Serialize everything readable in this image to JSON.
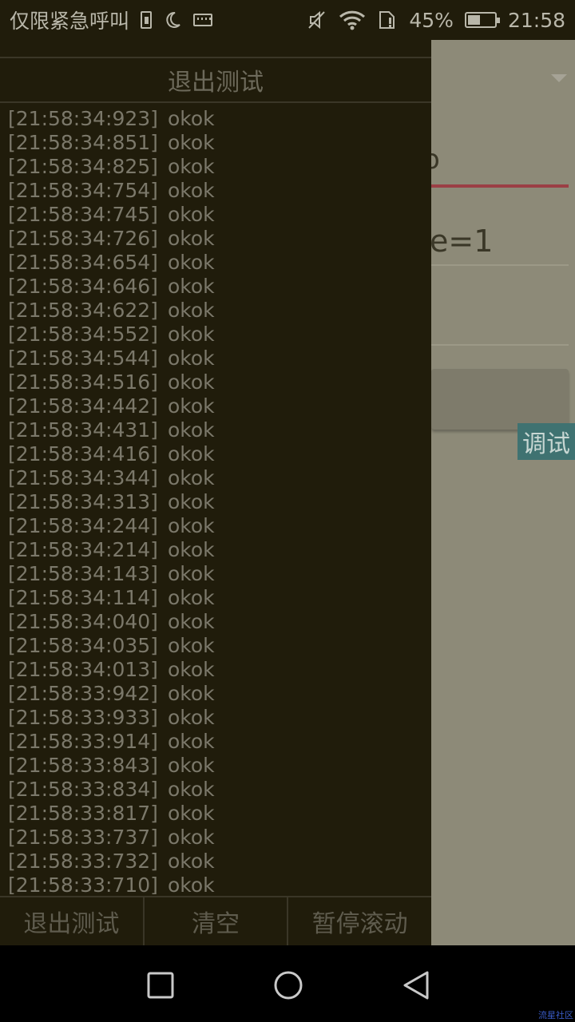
{
  "status_bar": {
    "carrier": "仅限紧急呼叫",
    "icons_left": [
      "sim-card-icon",
      "moon-icon",
      "keyboard-icon"
    ],
    "icons_right": [
      "mute-icon",
      "wifi-icon",
      "sim-alert-icon",
      "battery-icon"
    ],
    "battery_percent": "45%",
    "time": "21:58"
  },
  "background_app": {
    "fragment_1": "o",
    "fragment_2": "e=1",
    "debug_tab_label": "调试"
  },
  "debug_panel": {
    "header_label": "退出测试",
    "logs": [
      {
        "time": "[21:58:34:923]",
        "msg": "okok"
      },
      {
        "time": "[21:58:34:851]",
        "msg": "okok"
      },
      {
        "time": "[21:58:34:825]",
        "msg": "okok"
      },
      {
        "time": "[21:58:34:754]",
        "msg": "okok"
      },
      {
        "time": "[21:58:34:745]",
        "msg": "okok"
      },
      {
        "time": "[21:58:34:726]",
        "msg": "okok"
      },
      {
        "time": "[21:58:34:654]",
        "msg": "okok"
      },
      {
        "time": "[21:58:34:646]",
        "msg": "okok"
      },
      {
        "time": "[21:58:34:622]",
        "msg": "okok"
      },
      {
        "time": "[21:58:34:552]",
        "msg": "okok"
      },
      {
        "time": "[21:58:34:544]",
        "msg": "okok"
      },
      {
        "time": "[21:58:34:516]",
        "msg": "okok"
      },
      {
        "time": "[21:58:34:442]",
        "msg": "okok"
      },
      {
        "time": "[21:58:34:431]",
        "msg": "okok"
      },
      {
        "time": "[21:58:34:416]",
        "msg": "okok"
      },
      {
        "time": "[21:58:34:344]",
        "msg": "okok"
      },
      {
        "time": "[21:58:34:313]",
        "msg": "okok"
      },
      {
        "time": "[21:58:34:244]",
        "msg": "okok"
      },
      {
        "time": "[21:58:34:214]",
        "msg": "okok"
      },
      {
        "time": "[21:58:34:143]",
        "msg": "okok"
      },
      {
        "time": "[21:58:34:114]",
        "msg": "okok"
      },
      {
        "time": "[21:58:34:040]",
        "msg": "okok"
      },
      {
        "time": "[21:58:34:035]",
        "msg": "okok"
      },
      {
        "time": "[21:58:34:013]",
        "msg": "okok"
      },
      {
        "time": "[21:58:33:942]",
        "msg": "okok"
      },
      {
        "time": "[21:58:33:933]",
        "msg": "okok"
      },
      {
        "time": "[21:58:33:914]",
        "msg": "okok"
      },
      {
        "time": "[21:58:33:843]",
        "msg": "okok"
      },
      {
        "time": "[21:58:33:834]",
        "msg": "okok"
      },
      {
        "time": "[21:58:33:817]",
        "msg": "okok"
      },
      {
        "time": "[21:58:33:737]",
        "msg": "okok"
      },
      {
        "time": "[21:58:33:732]",
        "msg": "okok"
      },
      {
        "time": "[21:58:33:710]",
        "msg": "okok"
      }
    ],
    "bottom_buttons": {
      "exit": "退出测试",
      "clear": "清空",
      "pause_scroll": "暂停滚动"
    }
  },
  "nav_bar": {
    "recent_icon": "square-recent-apps-icon",
    "home_icon": "circle-home-icon",
    "back_icon": "triangle-back-icon"
  },
  "watermark": "流星社区"
}
